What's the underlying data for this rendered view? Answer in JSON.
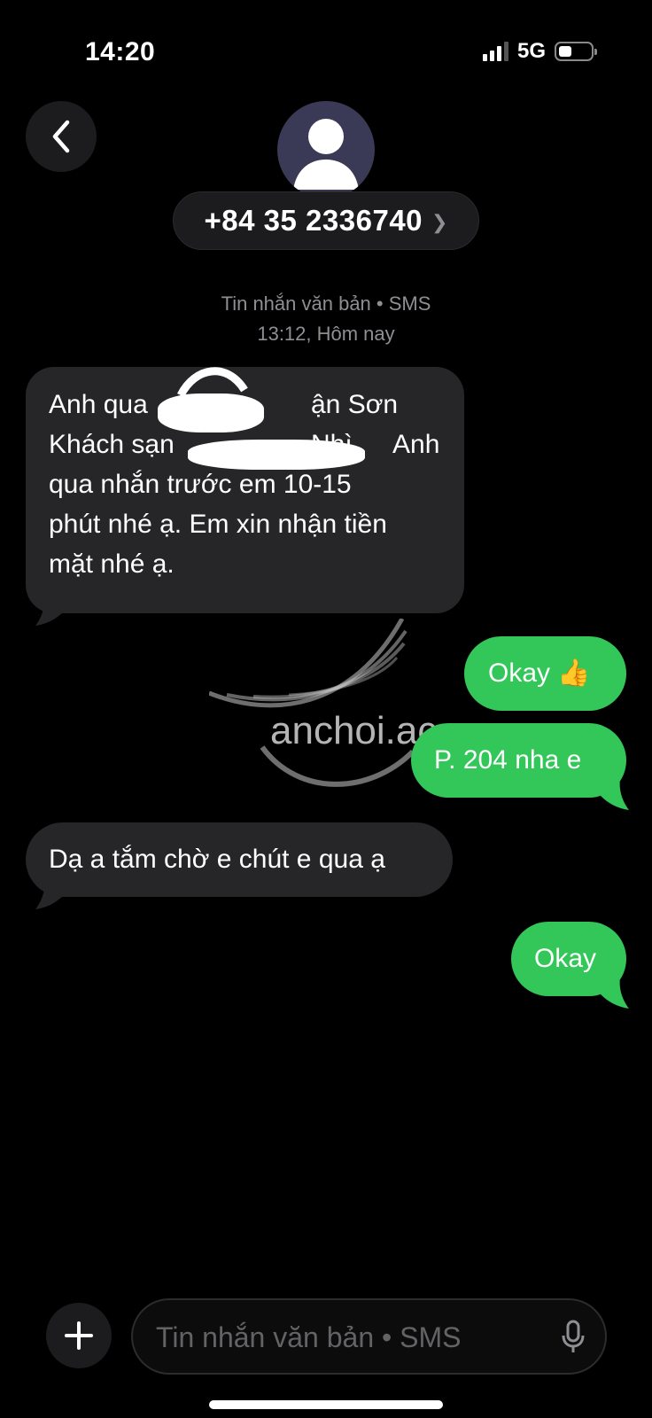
{
  "status_bar": {
    "time": "14:20",
    "network": "5G"
  },
  "header": {
    "contact_number": "+84 35 2336740"
  },
  "conversation": {
    "meta_service": "Tin nhắn văn bản • SMS",
    "meta_time": "13:12, Hôm nay",
    "messages": [
      {
        "direction": "incoming",
        "lines": [
          "Anh qua",
          "ận Sơn Nhì.",
          "Khách sạn",
          "Anh",
          "qua nhắn trước em 10-15",
          "phút nhé ạ. Em xin nhận tiền",
          "mặt nhé ạ."
        ]
      },
      {
        "direction": "outgoing",
        "text": "Okay 👍"
      },
      {
        "direction": "outgoing",
        "text": "P. 204 nha e"
      },
      {
        "direction": "incoming",
        "text": "Dạ a tắm chờ e chút e qua ạ"
      },
      {
        "direction": "outgoing",
        "text": "Okay"
      }
    ]
  },
  "watermark": {
    "text": "anchoi.ac"
  },
  "compose": {
    "placeholder": "Tin nhắn văn bản • SMS"
  },
  "colors": {
    "outgoing_bubble": "#33c759",
    "incoming_bubble": "#262628",
    "background": "#000000"
  },
  "icons": [
    "back-chevron-icon",
    "person-icon",
    "chevron-right-icon",
    "plus-icon",
    "microphone-icon",
    "signal-icon",
    "battery-icon",
    "thumbs-up-emoji"
  ]
}
